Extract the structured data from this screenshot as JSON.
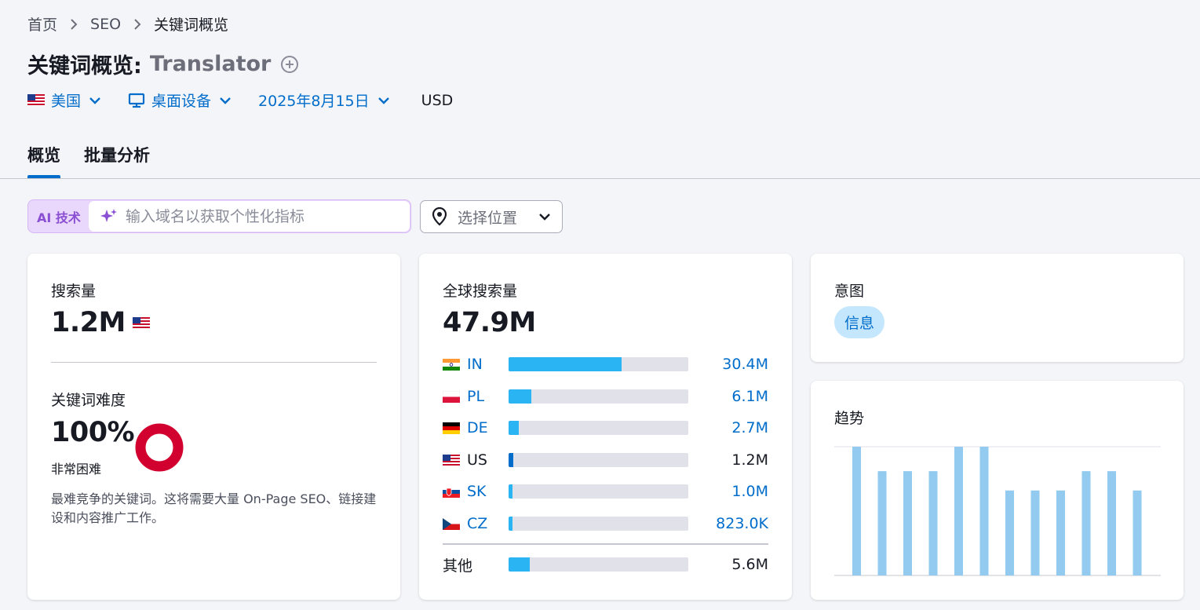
{
  "breadcrumb": {
    "home": "首页",
    "seo": "SEO",
    "current": "关键词概览"
  },
  "title": {
    "prefix": "关键词概览:",
    "keyword": "Translator"
  },
  "filters": {
    "country": "美国",
    "device": "桌面设备",
    "date": "2025年8月15日",
    "currency": "USD"
  },
  "tabs": [
    {
      "label": "概览"
    },
    {
      "label": "批量分析"
    }
  ],
  "ai": {
    "label": "AI 技术",
    "placeholder": "输入域名以获取个性化指标"
  },
  "location": {
    "placeholder": "选择位置"
  },
  "volume": {
    "title": "搜索量",
    "value": "1.2M"
  },
  "difficulty": {
    "title": "关键词难度",
    "value": "100%",
    "percent": 100,
    "label": "非常困难",
    "description": "最难竞争的关键词。这将需要大量 On-Page SEO、链接建设和内容推广工作。",
    "color": "#d1002f"
  },
  "global_volume": {
    "title": "全球搜索量",
    "value": "47.9M",
    "countries": [
      {
        "code": "IN",
        "value": "30.4M",
        "share": 0.63
      },
      {
        "code": "PL",
        "value": "6.1M",
        "share": 0.127
      },
      {
        "code": "DE",
        "value": "2.7M",
        "share": 0.056
      },
      {
        "code": "US",
        "value": "1.2M",
        "share": 0.025
      },
      {
        "code": "SK",
        "value": "1.0M",
        "share": 0.02
      },
      {
        "code": "CZ",
        "value": "823.0K",
        "share": 0.017
      }
    ],
    "other": {
      "label": "其他",
      "value": "5.6M",
      "share": 0.117
    }
  },
  "intent": {
    "title": "意图",
    "badge": "信息"
  },
  "trend": {
    "title": "趋势"
  },
  "chart_data": {
    "type": "bar",
    "title": "趋势",
    "categories": [
      "1",
      "2",
      "3",
      "4",
      "5",
      "6",
      "7",
      "8",
      "9",
      "10",
      "11",
      "12"
    ],
    "values": [
      100,
      81,
      81,
      81,
      100,
      100,
      66,
      66,
      66,
      81,
      81,
      66
    ],
    "ylim": [
      0,
      100
    ],
    "color": "#92caf0"
  }
}
